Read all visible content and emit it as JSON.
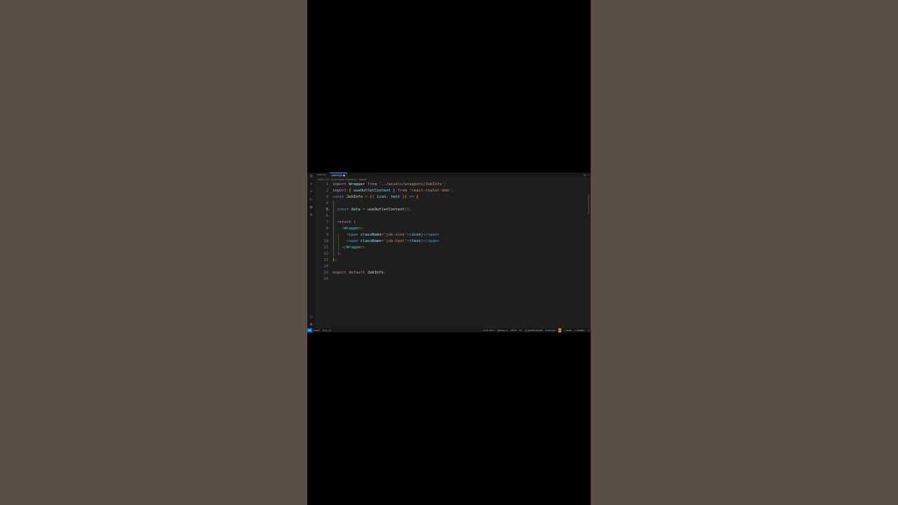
{
  "tabs": [
    {
      "label": "Stats.jsx",
      "active": false
    },
    {
      "label": "JobInfo.jsx",
      "active": true,
      "modified_mark": "●"
    }
  ],
  "breadcrumb": "client › src › components › JobInfo.jsx › JobInfo",
  "cursor_line": 5,
  "code_lines": [
    {
      "n": "1",
      "tokens": [
        [
          "kw",
          "import "
        ],
        [
          "vr",
          "Wrapper "
        ],
        [
          "kw",
          "from "
        ],
        [
          "st",
          "'../assets/wrappers/JobInfo'"
        ],
        [
          "pu",
          ";"
        ]
      ]
    },
    {
      "n": "2",
      "tokens": [
        [
          "kw",
          "import "
        ],
        [
          "br",
          "{ "
        ],
        [
          "vr",
          "useOutletContext "
        ],
        [
          "br",
          "} "
        ],
        [
          "kw",
          "from "
        ],
        [
          "st",
          "'react-router-dom'"
        ],
        [
          "pu",
          ";"
        ]
      ]
    },
    {
      "n": "3",
      "tokens": [
        [
          "kb",
          "const "
        ],
        [
          "fn",
          "JobInfo "
        ],
        [
          "pu",
          "= "
        ],
        [
          "br",
          "("
        ],
        [
          "br2",
          "{ "
        ],
        [
          "vr",
          "icon"
        ],
        [
          "pu",
          ", "
        ],
        [
          "vr",
          "text "
        ],
        [
          "br2",
          "}"
        ],
        [
          "br",
          ") "
        ],
        [
          "kb",
          "=> "
        ],
        [
          "br",
          "{"
        ]
      ]
    },
    {
      "n": "4",
      "tokens": []
    },
    {
      "n": "5",
      "tokens": [
        [
          "pu",
          "  "
        ],
        [
          "kb",
          "const "
        ],
        [
          "vr",
          "data "
        ],
        [
          "pu",
          "= "
        ],
        [
          "fn",
          "useOutletContext"
        ],
        [
          "br2",
          "()"
        ],
        [
          "pu",
          ";"
        ]
      ]
    },
    {
      "n": "6",
      "tokens": []
    },
    {
      "n": "7",
      "tokens": [
        [
          "pu",
          "  "
        ],
        [
          "kw",
          "return "
        ],
        [
          "br2",
          "("
        ]
      ]
    },
    {
      "n": "8",
      "tokens": [
        [
          "pu",
          "    "
        ],
        [
          "pu",
          "<"
        ],
        [
          "tg",
          "Wrapper"
        ],
        [
          "pu",
          ">"
        ]
      ]
    },
    {
      "n": "9",
      "tokens": [
        [
          "pu",
          "      "
        ],
        [
          "pu",
          "<"
        ],
        [
          "kb",
          "span "
        ],
        [
          "vr",
          "className"
        ],
        [
          "pu",
          "="
        ],
        [
          "st",
          "'job-icon'"
        ],
        [
          "pu",
          ">"
        ],
        [
          "kb",
          "{"
        ],
        [
          "vr",
          "icon"
        ],
        [
          "kb",
          "}"
        ],
        [
          "pu",
          "</"
        ],
        [
          "kb",
          "span"
        ],
        [
          "pu",
          ">"
        ]
      ]
    },
    {
      "n": "10",
      "tokens": [
        [
          "pu",
          "      "
        ],
        [
          "pu",
          "<"
        ],
        [
          "kb",
          "span "
        ],
        [
          "vr",
          "className"
        ],
        [
          "pu",
          "="
        ],
        [
          "st",
          "'job-text'"
        ],
        [
          "pu",
          ">"
        ],
        [
          "kb",
          "{"
        ],
        [
          "vr",
          "text"
        ],
        [
          "kb",
          "}"
        ],
        [
          "pu",
          "</"
        ],
        [
          "kb",
          "span"
        ],
        [
          "pu",
          ">"
        ]
      ]
    },
    {
      "n": "11",
      "tokens": [
        [
          "pu",
          "    "
        ],
        [
          "pu",
          "</"
        ],
        [
          "tg",
          "Wrapper"
        ],
        [
          "pu",
          ">"
        ]
      ]
    },
    {
      "n": "12",
      "tokens": [
        [
          "pu",
          "  "
        ],
        [
          "br2",
          ")"
        ],
        [
          "pu",
          ";"
        ]
      ]
    },
    {
      "n": "13",
      "tokens": [
        [
          "br",
          "}"
        ],
        [
          "pu",
          ";"
        ]
      ]
    },
    {
      "n": "14",
      "tokens": []
    },
    {
      "n": "15",
      "tokens": [
        [
          "kw",
          "export "
        ],
        [
          "kw",
          "default "
        ],
        [
          "fn",
          "JobInfo"
        ],
        [
          "pu",
          ";"
        ]
      ]
    },
    {
      "n": "16",
      "tokens": []
    }
  ],
  "status": {
    "left": [
      "main*",
      "⊗ 0 △ 0"
    ],
    "right": [
      "Ln 5, Col 1",
      "Spaces: 2",
      "UTF-8",
      "LF",
      "{} JavaScript JSX",
      "⊘ Go Live",
      "✓ Spell",
      "✓ Prettier"
    ],
    "warning": "0"
  },
  "icons": {
    "activity": [
      "files-icon",
      "search-icon",
      "source-control-icon",
      "run-debug-icon",
      "extensions-icon",
      "remote-icon"
    ],
    "activity_bottom": [
      "account-icon",
      "settings-gear-icon"
    ]
  }
}
